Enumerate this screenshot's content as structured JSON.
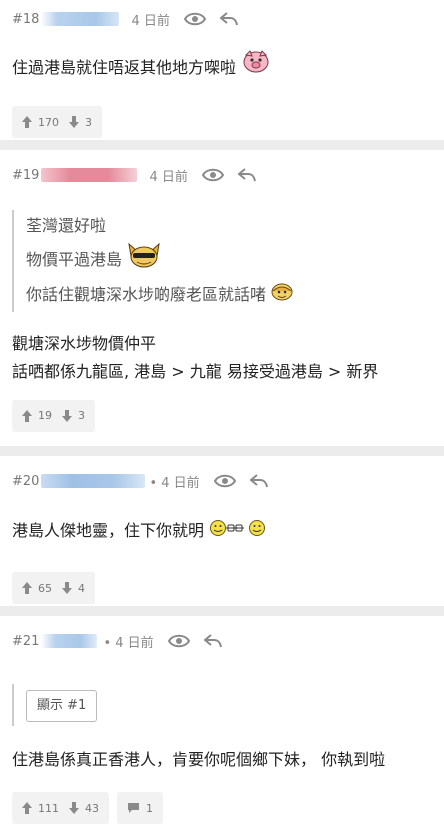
{
  "posts": [
    {
      "num": "#18",
      "time": "4 日前",
      "content": [
        "住過港島就住唔返其他地方㗎啦"
      ],
      "votes": {
        "up": "170",
        "down": "3"
      }
    },
    {
      "num": "#19",
      "time": "4 日前",
      "quote": [
        "荃灣還好啦",
        "物價平過港島",
        "你話住觀塘深水埗啲廢老區就話啫"
      ],
      "content": [
        "觀塘深水埗物價仲平",
        "話哂都係九龍區, 港島 > 九龍 易接受過港島 > 新界"
      ],
      "votes": {
        "up": "19",
        "down": "3"
      }
    },
    {
      "num": "#20",
      "time": "• 4 日前",
      "content": [
        "港島人傑地靈，住下你就明"
      ],
      "votes": {
        "up": "65",
        "down": "4"
      }
    },
    {
      "num": "#21",
      "time": "• 4 日前",
      "show_button": "顯示 #1",
      "content": [
        "住港島係真正香港人，肯要你呢個鄉下妹， 你執到啦"
      ],
      "votes": {
        "up": "111",
        "down": "43",
        "replies": "1"
      }
    }
  ],
  "icons": {
    "eye": "eye-icon",
    "reply": "reply-arrow-icon",
    "up": "thumb-up-arrow-icon",
    "down": "thumb-down-arrow-icon",
    "comment": "comment-bubble-icon"
  },
  "colors": {
    "blur_blue": "#a9c7e8",
    "blur_red": "#e58a9a",
    "icon_gray": "#8a8a8a"
  }
}
